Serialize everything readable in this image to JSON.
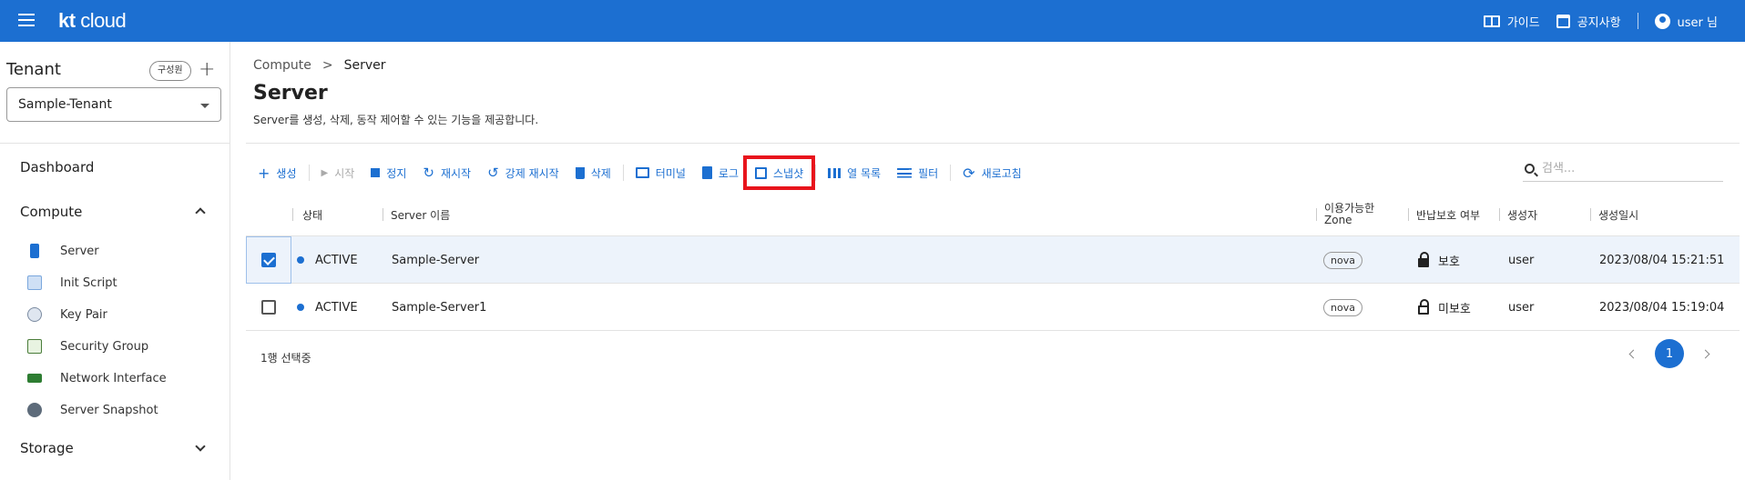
{
  "header": {
    "logo_kt": "kt",
    "logo_cloud": "cloud",
    "guide_label": "가이드",
    "notice_label": "공지사항",
    "user_label": "user 님"
  },
  "sidebar": {
    "tenant_title": "Tenant",
    "member_chip": "구성원",
    "add_symbol": "+",
    "tenant_selected": "Sample-Tenant",
    "dashboard": "Dashboard",
    "compute": "Compute",
    "compute_items": [
      {
        "label": "Server",
        "icon": "server-icon"
      },
      {
        "label": "Init Script",
        "icon": "script-icon"
      },
      {
        "label": "Key Pair",
        "icon": "key-pair-icon"
      },
      {
        "label": "Security Group",
        "icon": "security-group-icon"
      },
      {
        "label": "Network Interface",
        "icon": "network-interface-icon"
      },
      {
        "label": "Server Snapshot",
        "icon": "snapshot-disk-icon"
      }
    ],
    "storage": "Storage"
  },
  "breadcrumb": {
    "parent": "Compute",
    "separator": ">",
    "current": "Server"
  },
  "page": {
    "title": "Server",
    "description": "Server를 생성, 삭제, 동작 제어할 수 있는 기능을 제공합니다."
  },
  "toolbar": {
    "create": "생성",
    "start": "시작",
    "stop": "정지",
    "restart": "재시작",
    "force_restart": "강제 재시작",
    "delete": "삭제",
    "terminal": "터미널",
    "log": "로그",
    "snapshot": "스냅샷",
    "columns": "열 목록",
    "filter": "필터",
    "refresh": "새로고침"
  },
  "search": {
    "placeholder": "검색..."
  },
  "table": {
    "headers": {
      "status": "상태",
      "name": "Server 이름",
      "zone_line1": "이용가능한",
      "zone_line2": "Zone",
      "protection": "반납보호 여부",
      "creator": "생성자",
      "created": "생성일시"
    },
    "rows": [
      {
        "selected": true,
        "status": "ACTIVE",
        "name": "Sample-Server",
        "zone": "nova",
        "protection": "보호",
        "creator": "user",
        "created": "2023/08/04 15:21:51"
      },
      {
        "selected": false,
        "status": "ACTIVE",
        "name": "Sample-Server1",
        "zone": "nova",
        "protection": "미보호",
        "creator": "user",
        "created": "2023/08/04 15:19:04"
      }
    ]
  },
  "footer": {
    "selection": "1행 선택중"
  },
  "pagination": {
    "current_page": "1"
  },
  "colors": {
    "primary": "#1c6fd1",
    "highlight": "#e8141c"
  }
}
